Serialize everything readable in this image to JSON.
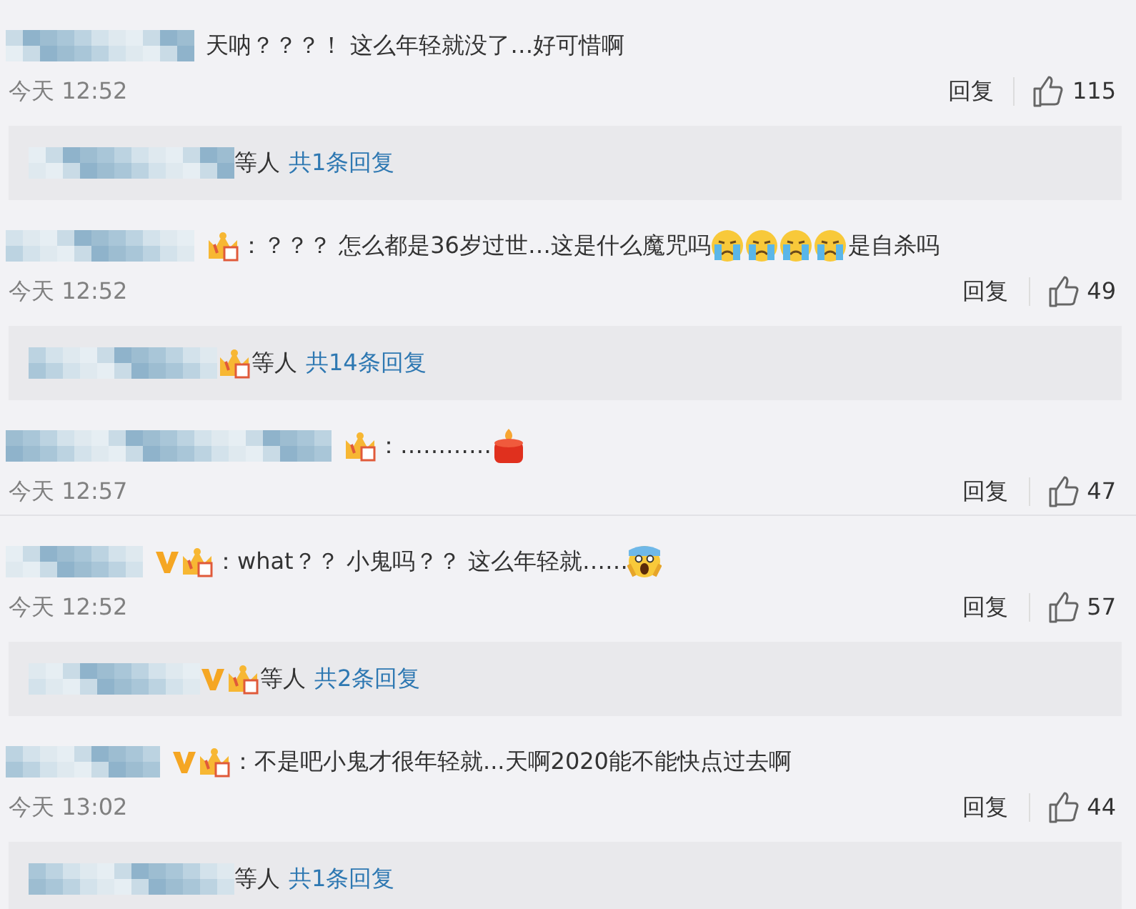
{
  "comments": [
    {
      "verified": false,
      "crown": false,
      "segments": [
        {
          "kind": "text",
          "text": "天呐？？？！ 这么年轻就没了…好可惜啊"
        }
      ],
      "time": "今天 12:52",
      "reply_label": "回复",
      "likes": "115",
      "replies": {
        "verified": false,
        "crown": false,
        "suffix": "等人",
        "link": "共1条回复"
      }
    },
    {
      "verified": false,
      "crown": true,
      "segments": [
        {
          "kind": "text",
          "text": "：？？？ 怎么都是36岁过世…这是什么魔咒吗"
        },
        {
          "kind": "crying-face"
        },
        {
          "kind": "crying-face"
        },
        {
          "kind": "crying-face"
        },
        {
          "kind": "crying-face"
        },
        {
          "kind": "text",
          "text": "是自杀吗"
        }
      ],
      "time": "今天 12:52",
      "reply_label": "回复",
      "likes": "49",
      "replies": {
        "verified": false,
        "crown": true,
        "suffix": "等人",
        "link": "共14条回复"
      }
    },
    {
      "verified": false,
      "crown": true,
      "segments": [
        {
          "kind": "text",
          "text": "：…………"
        },
        {
          "kind": "candle"
        }
      ],
      "time": "今天 12:57",
      "reply_label": "回复",
      "likes": "47"
    },
    {
      "verified": true,
      "crown": true,
      "segments": [
        {
          "kind": "text",
          "text": "：what？？ 小鬼吗？？ 这么年轻就……"
        },
        {
          "kind": "scared-face"
        }
      ],
      "time": "今天 12:52",
      "reply_label": "回复",
      "likes": "57",
      "replies": {
        "verified": true,
        "crown": true,
        "suffix": "等人",
        "link": "共2条回复"
      }
    },
    {
      "verified": true,
      "crown": true,
      "segments": [
        {
          "kind": "text",
          "text": "：不是吧小鬼才很年轻就...天啊2020能不能快点过去啊"
        }
      ],
      "time": "今天 13:02",
      "reply_label": "回复",
      "likes": "44",
      "replies": {
        "verified": false,
        "crown": false,
        "suffix": "等人",
        "link": "共1条回复"
      }
    }
  ]
}
